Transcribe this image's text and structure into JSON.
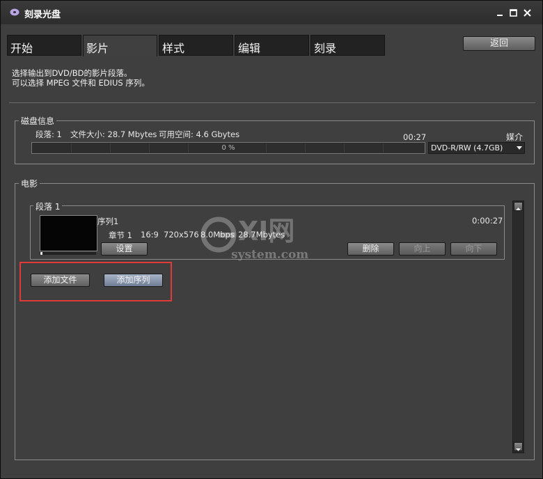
{
  "window": {
    "title": "刻录光盘",
    "controls": [
      "minimize",
      "maximize",
      "close"
    ]
  },
  "tabs": [
    {
      "label": "开始",
      "active": false
    },
    {
      "label": "影片",
      "active": true
    },
    {
      "label": "样式",
      "active": false
    },
    {
      "label": "编辑",
      "active": false
    },
    {
      "label": "刻录",
      "active": false
    }
  ],
  "toolbar": {
    "back_label": "返回"
  },
  "description": {
    "line1": "选择输出到DVD/BD的影片段落。",
    "line2": "可以选择 MPEG 文件和 EDIUS 序列。"
  },
  "disc_info": {
    "legend": "磁盘信息",
    "segments": "段落: 1",
    "file_size": "文件大小: 28.7 Mbytes",
    "free_space": "可用空间: 4.6 Gbytes",
    "duration": "00:27",
    "progress_text": "0 %",
    "progress_value": 0,
    "media_label": "媒介",
    "media_value": "DVD-R/RW (4.7GB)"
  },
  "movie": {
    "legend": "电影",
    "segment": {
      "legend": "段落 1",
      "sequence": "序列1",
      "duration": "0:00:27",
      "chapter": "章节 1",
      "aspect": "16:9",
      "resolution": "720x576",
      "bitrate": "8.0Mbps",
      "size": "28.7Mbytes",
      "settings_label": "设置",
      "delete_label": "删除",
      "up_label": "向上",
      "down_label": "向下"
    },
    "add_file_label": "添加文件",
    "add_sequence_label": "添加序列"
  },
  "watermark": {
    "brand": "GXI网",
    "domain": "system.com"
  },
  "colors": {
    "highlight": "#e23a3a",
    "background": "#3f3f3f",
    "tab_inactive": "#222222"
  }
}
